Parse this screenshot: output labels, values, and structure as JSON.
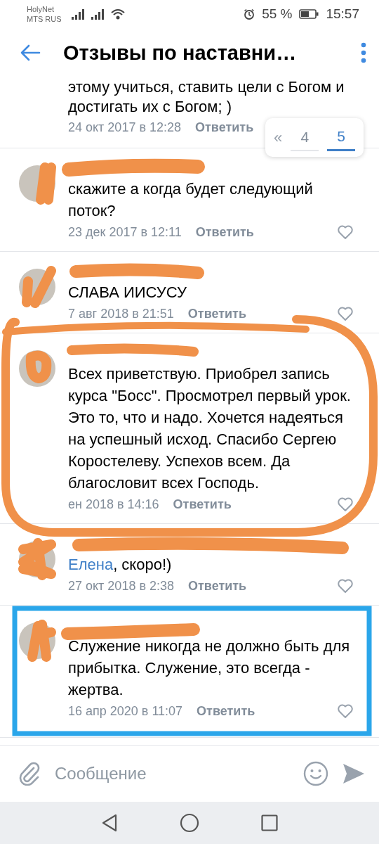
{
  "status_bar": {
    "carrier_1": "HolyNet",
    "carrier_2": "MTS RUS",
    "battery": "55 %",
    "time": "15:57"
  },
  "header": {
    "title": "Отзывы по наставни…"
  },
  "pager": {
    "first": "«",
    "pages": [
      {
        "label": "4",
        "selected": false
      },
      {
        "label": "5",
        "selected": true
      }
    ]
  },
  "comments": [
    {
      "kind": "cut",
      "text": "этому учиться, ставить цели с Богом и достигать их с Богом; )",
      "date": "24 окт 2017 в 12:28",
      "reply": "Ответить"
    },
    {
      "kind": "full",
      "text": "скажите а когда будет следующий поток?",
      "date": "23 дек 2017 в 12:11",
      "reply": "Ответить"
    },
    {
      "kind": "full",
      "text": "СЛАВА ИИСУСУ",
      "date": "7 авг 2018 в 21:51",
      "reply": "Ответить"
    },
    {
      "kind": "full",
      "text": "Всех приветствую. Приобрел запись курса \"Босс\". Просмотрел первый урок. Это то, что и надо. Хочется надеяться на успешный исход. Спасибо Сергею Коростелеву. Успехов всем. Да благословит всех Господь.",
      "date": "ен 2018 в 14:16",
      "reply": "Ответить"
    },
    {
      "kind": "full",
      "reply_to": "Елена",
      "text": ", скоро!)",
      "date": "27 окт 2018 в 2:38",
      "reply": "Ответить"
    },
    {
      "kind": "full",
      "text": "Служение никогда не должно быть для прибытка. Служение, это всегда - жертва.",
      "date": "16 апр 2020 в 11:07",
      "reply": "Ответить"
    }
  ],
  "composer": {
    "placeholder": "Сообщение"
  }
}
